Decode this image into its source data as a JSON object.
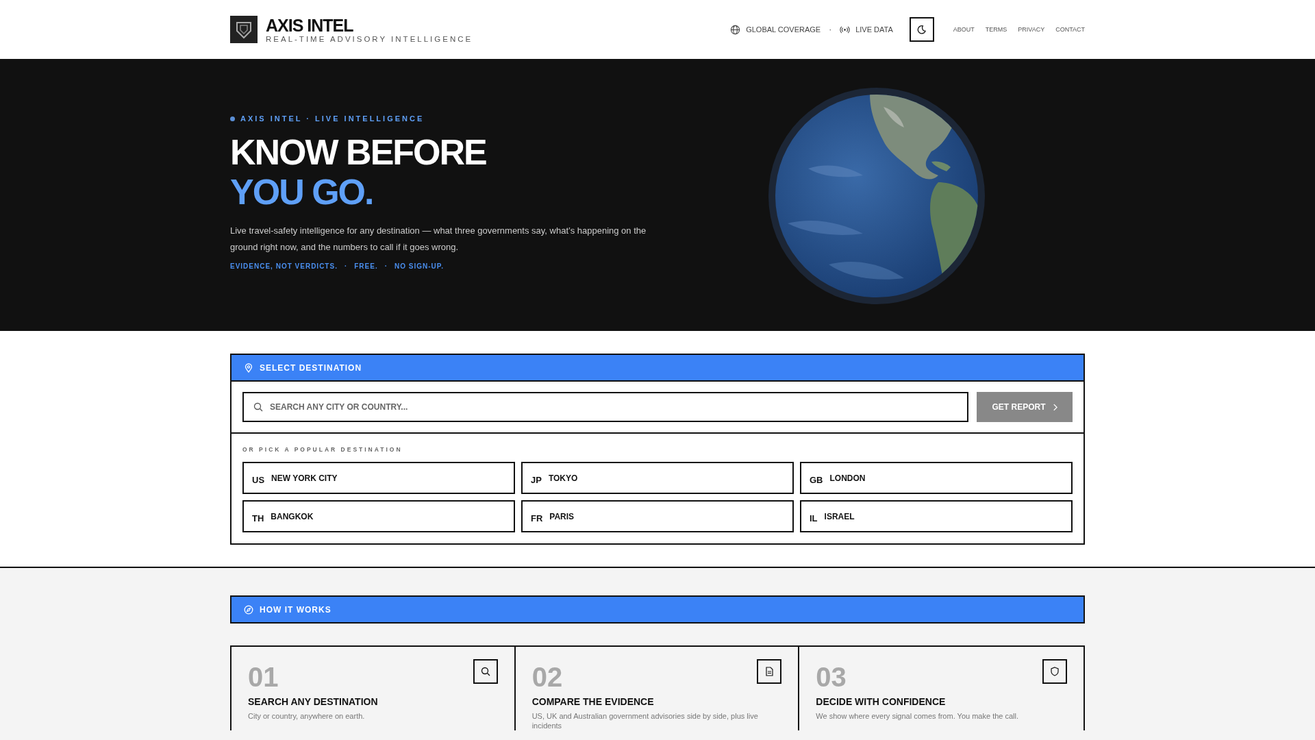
{
  "header": {
    "logo_title": "AXIS INTEL",
    "logo_subtitle": "REAL-TIME ADVISORY INTELLIGENCE",
    "status": [
      {
        "kind": "globe",
        "label": "GLOBAL COVERAGE"
      },
      {
        "kind": "signal",
        "label": "LIVE DATA"
      }
    ],
    "separator": "·",
    "links": [
      "ABOUT",
      "TERMS",
      "PRIVACY",
      "CONTACT"
    ]
  },
  "hero": {
    "eyebrow": "AXIS INTEL · LIVE INTELLIGENCE",
    "title_line_1": "KNOW BEFORE",
    "title_line_2": "YOU GO.",
    "description": "Live travel-safety intelligence for any destination — what three governments say, what’s happening on the ground right now, and the numbers to call if it goes wrong.",
    "taglines": [
      "EVIDENCE, NOT VERDICTS.",
      "·",
      "FREE.",
      "·",
      "NO SIGN-UP."
    ]
  },
  "destination": {
    "title": "SELECT DESTINATION",
    "search": {
      "placeholder": "SEARCH ANY CITY OR COUNTRY..."
    },
    "button": "GET REPORT",
    "popular_label": "OR PICK A POPULAR DESTINATION",
    "items": [
      {
        "code": "US",
        "name": "NEW YORK CITY"
      },
      {
        "code": "JP",
        "name": "TOKYO"
      },
      {
        "code": "GB",
        "name": "LONDON"
      },
      {
        "code": "TH",
        "name": "BANGKOK"
      },
      {
        "code": "FR",
        "name": "PARIS"
      },
      {
        "code": "IL",
        "name": "ISRAEL"
      }
    ]
  },
  "how_it_works": {
    "title": "HOW IT WORKS",
    "steps": [
      {
        "number": "01",
        "kind": "search",
        "title": "SEARCH ANY DESTINATION",
        "description": "City or country, anywhere on earth."
      },
      {
        "number": "02",
        "kind": "document",
        "title": "COMPARE THE EVIDENCE",
        "description": "US, UK and Australian government advisories side by side, plus live incidents"
      },
      {
        "number": "03",
        "kind": "shield",
        "title": "DECIDE WITH CONFIDENCE",
        "description": "We show where every signal comes from. You make the call."
      }
    ]
  }
}
